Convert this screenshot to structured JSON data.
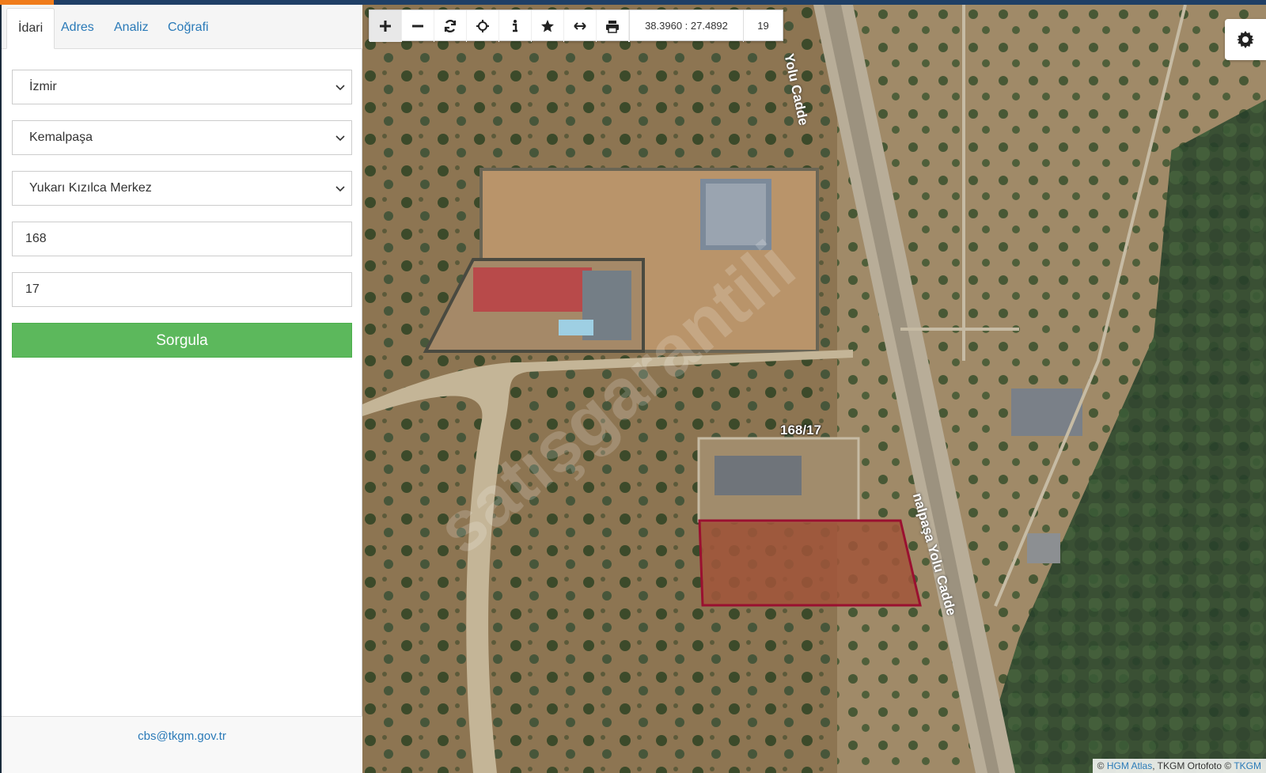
{
  "tabs": [
    {
      "label": "İdari",
      "active": true
    },
    {
      "label": "Adres"
    },
    {
      "label": "Analiz"
    },
    {
      "label": "Coğrafi"
    }
  ],
  "form": {
    "il": "İzmir",
    "ilce": "Kemalpaşa",
    "mahalle": "Yukarı Kızılca Merkez",
    "ada": "168",
    "parsel": "17",
    "submit_label": "Sorgula"
  },
  "footer": {
    "email": "cbs@tkgm.gov.tr"
  },
  "map": {
    "coordinates": "38.3960 : 27.4892",
    "zoom": "19",
    "parcel_label": "168/17",
    "road_label_top": "Yolu Cadde",
    "road_label_side": "nalpaşa Yolu Cadde",
    "watermark": "satışgarantili",
    "attribution": {
      "prefix": "© ",
      "hgm": "HGM Atlas",
      "middle": ", TKGM Ortofoto © ",
      "tkgm": "TKGM"
    }
  },
  "icons": [
    "zoom-in-icon",
    "zoom-out-icon",
    "refresh-icon",
    "locate-icon",
    "info-icon",
    "star-icon",
    "measure-icon",
    "print-icon",
    "gear-icon",
    "chevron-down-icon"
  ],
  "colors": {
    "accent": "#2a7ab8",
    "submit": "#5cb85c",
    "parcel_border": "#9a1030",
    "topbar": "#1f3f66",
    "topbar_accent": "#f07c1b"
  }
}
